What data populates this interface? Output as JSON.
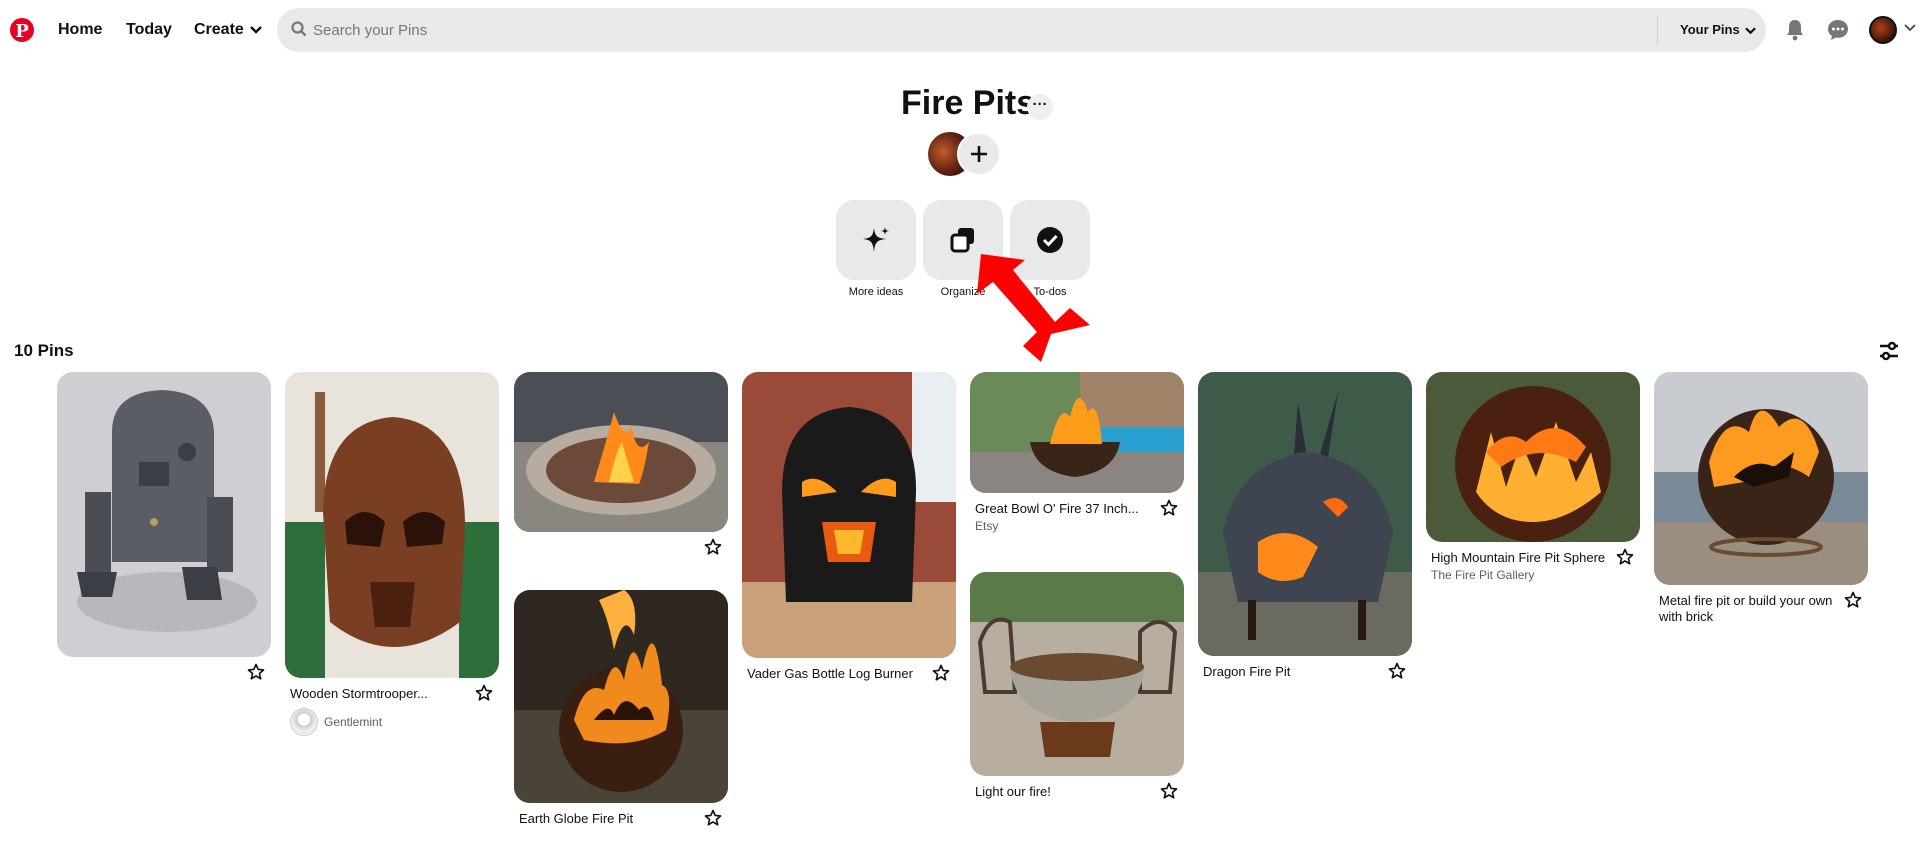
{
  "header": {
    "nav": {
      "home": "Home",
      "today": "Today",
      "create": "Create"
    },
    "search_placeholder": "Search your Pins",
    "your_pins": "Your Pins"
  },
  "board": {
    "title": "Fire Pits",
    "more_label": "···",
    "actions": {
      "more_ideas": "More ideas",
      "organize": "Organize",
      "todos": "To-dos"
    },
    "pin_count": "10 Pins"
  },
  "pins": [
    {
      "title": "",
      "source": ""
    },
    {
      "title": "Wooden Stormtrooper...",
      "source": "Gentlemint"
    },
    {
      "title": "",
      "source": ""
    },
    {
      "title": "Earth Globe Fire Pit",
      "source": ""
    },
    {
      "title": "Vader Gas Bottle Log Burner",
      "source": ""
    },
    {
      "title": "Great Bowl O' Fire 37 Inch...",
      "source": "Etsy"
    },
    {
      "title": "Light our fire!",
      "source": ""
    },
    {
      "title": "Dragon Fire Pit",
      "source": ""
    },
    {
      "title": "High Mountain Fire Pit Sphere",
      "source": "The Fire Pit Gallery"
    },
    {
      "title": "Metal fire pit or build your own with brick",
      "source": ""
    }
  ],
  "colors": {
    "brand": "#e60023",
    "annotation_arrow": "#ff0000",
    "tile_bg": "#e9e9e9"
  }
}
